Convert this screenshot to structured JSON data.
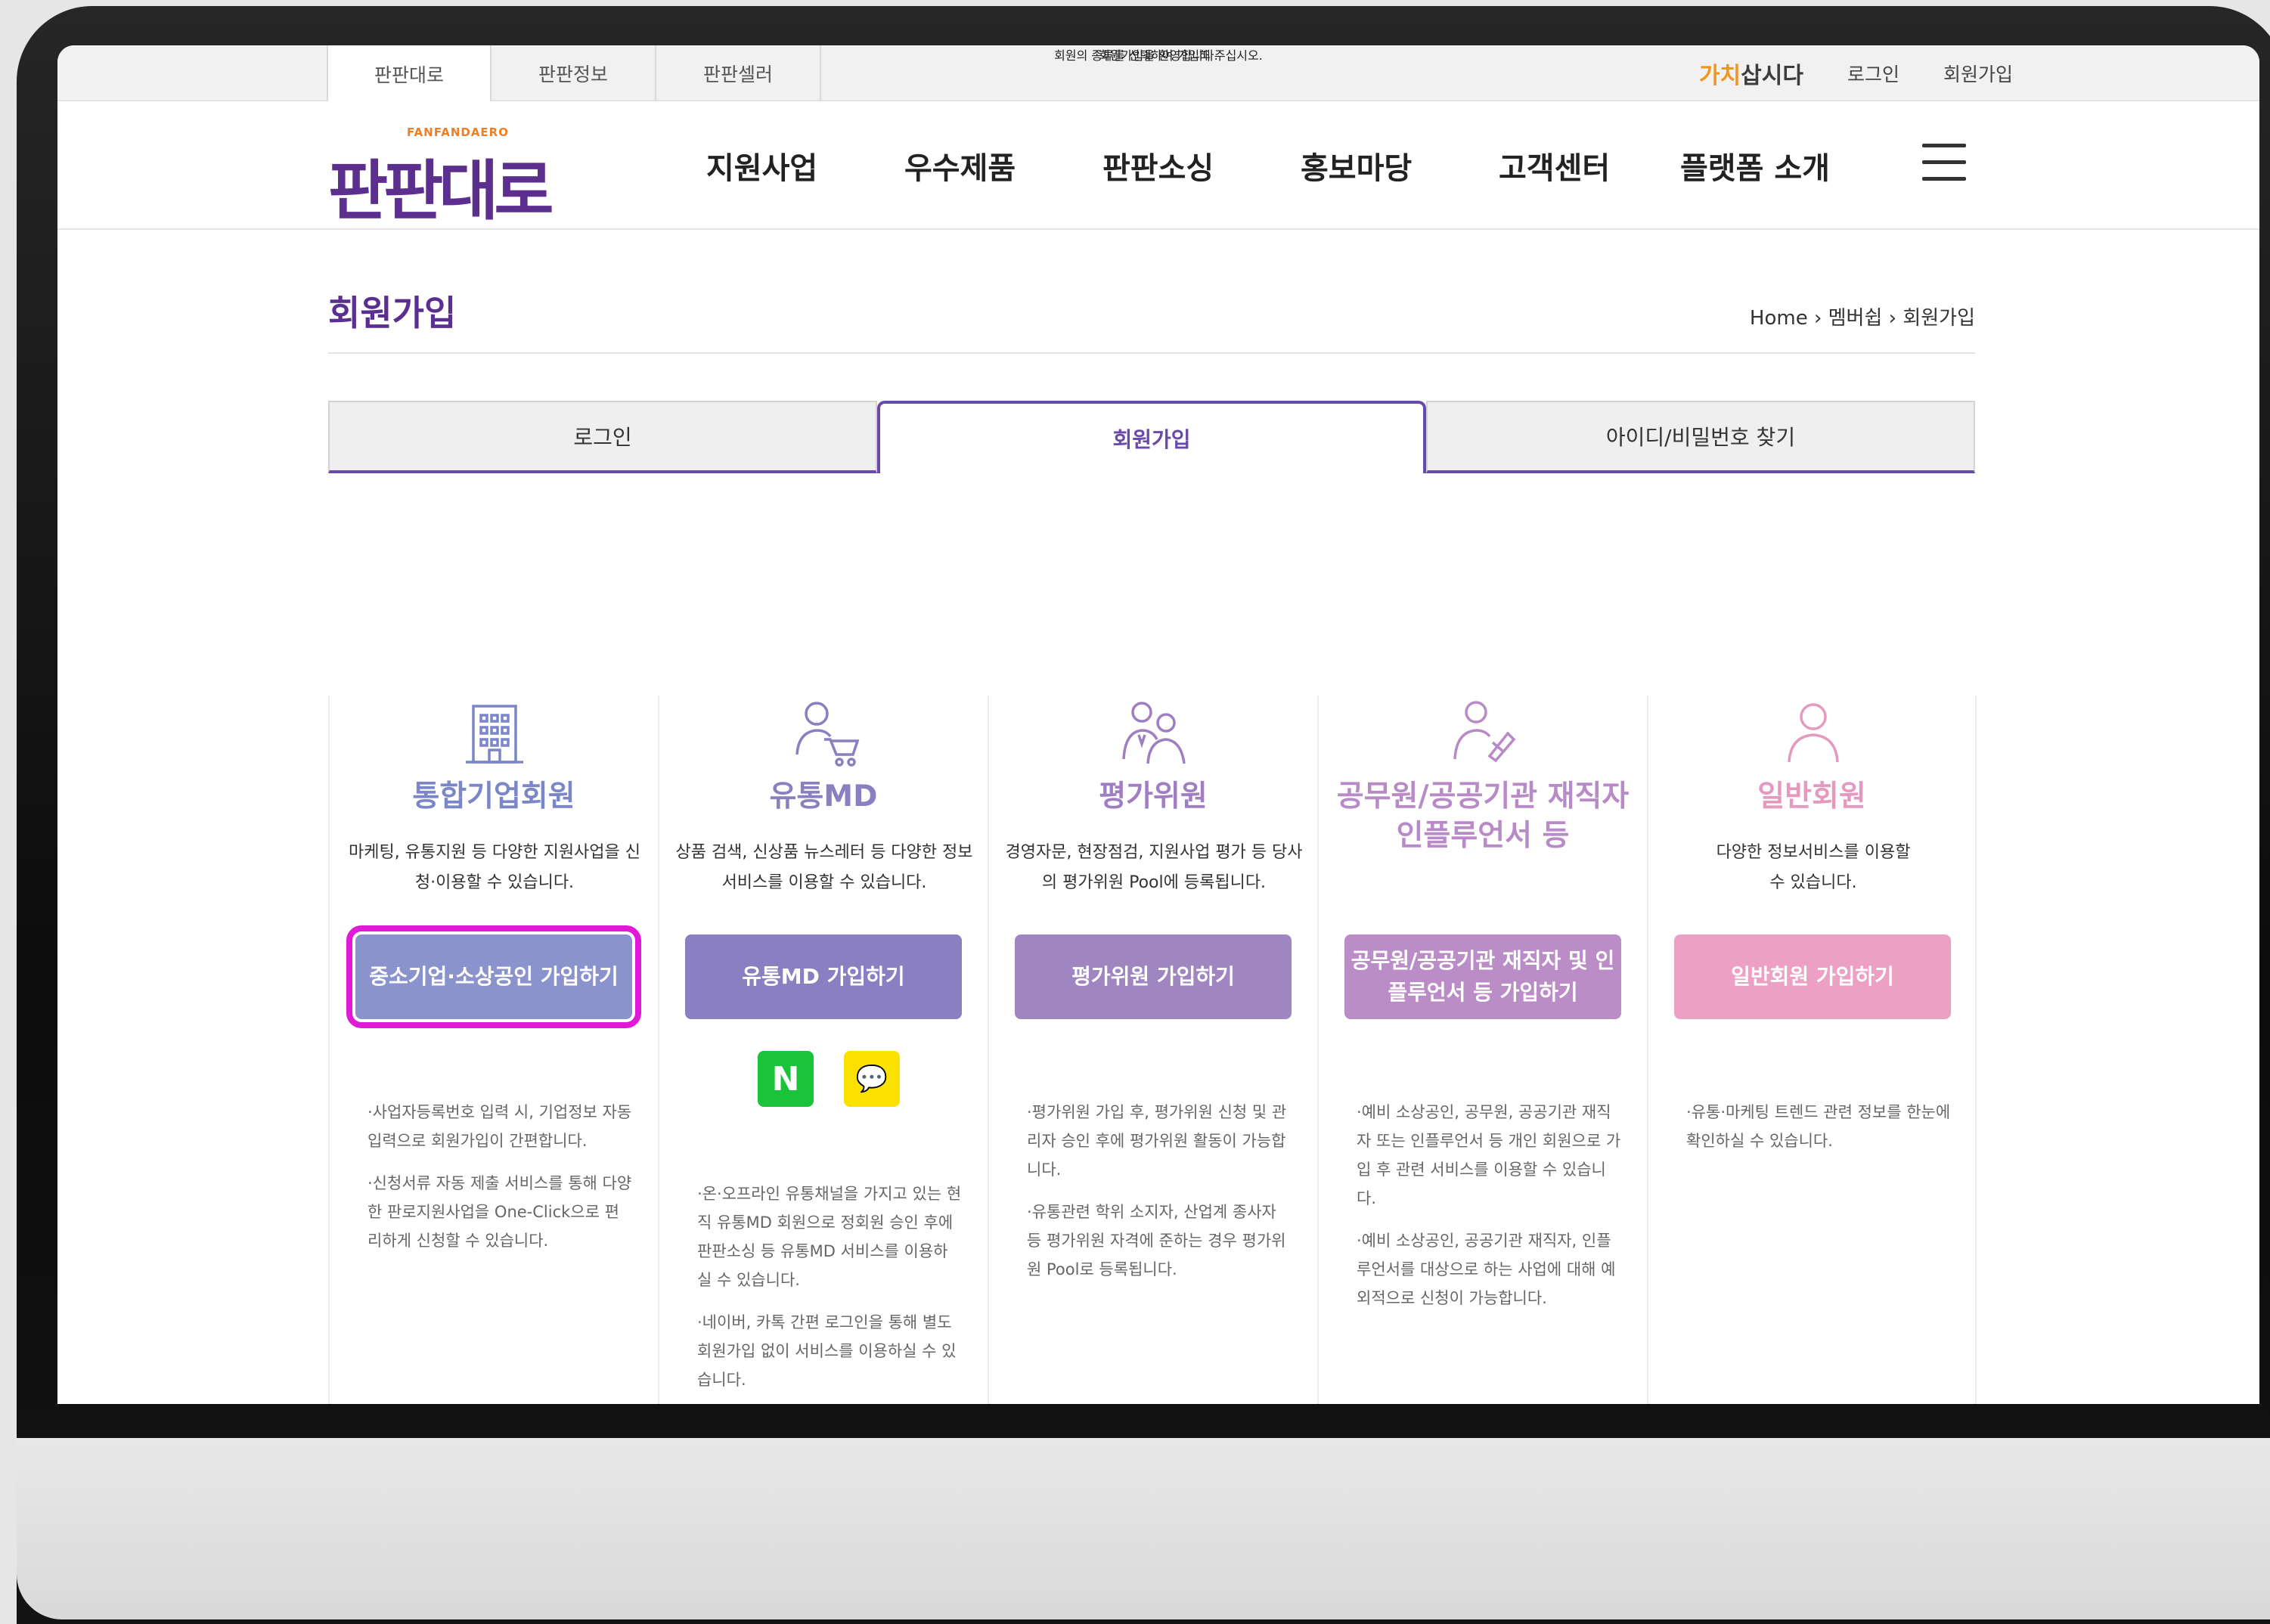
{
  "utilbar": {
    "tabs": [
      "판판대로",
      "판판정보",
      "판판셀러"
    ],
    "campaign_highlight": "가치",
    "campaign_rest": "삽시다",
    "login": "로그인",
    "signup": "회원가입"
  },
  "nav": {
    "logo_tag": "FANFANDAERO",
    "logo_word": "판판대로",
    "menu": [
      "지원사업",
      "우수제품",
      "판판소싱",
      "홍보마당",
      "고객센터",
      "플랫폼 소개"
    ]
  },
  "page": {
    "title": "회원가입",
    "breadcrumb": "Home › 멤버쉽 › 회원가입"
  },
  "tabs": [
    "로그인",
    "회원가입",
    "아이디/비밀번호 찾기"
  ],
  "welcome": {
    "line1": "회원가입을 환영합니다.",
    "line2": "회원의 종류를 선택하여 가입해 주십시오."
  },
  "members": [
    {
      "icon": "building-icon",
      "title": "통합기업회원",
      "desc": "마케팅, 유통지원 등 다양한 지원사업을 신청·이용할 수 있습니다.",
      "button": "중소기업·소상공인 가입하기",
      "notes": [
        "·사업자등록번호 입력 시, 기업정보 자동입력으로 회원가입이 간편합니다.",
        "·신청서류 자동 제출 서비스를 통해 다양한 판로지원사업을 One-Click으로 편리하게 신청할 수 있습니다."
      ],
      "color": "#8b93cc",
      "title_color": "#7b86c8"
    },
    {
      "icon": "shopping-cart-user-icon",
      "title": "유통MD",
      "desc": "상품 검색, 신상품 뉴스레터 등 다양한 정보서비스를 이용할 수 있습니다.",
      "button": "유통MD 가입하기",
      "notes": [
        "·온·오프라인 유통채널을 가지고 있는 현직 유통MD 회원으로 정회원 승인 후에 판판소싱 등 유통MD 서비스를 이용하실 수 있습니다.",
        "·네이버, 카톡 간편 로그인을 통해 별도 회원가입 없이 서비스를 이용하실 수 있습니다."
      ],
      "social": [
        "N",
        "💬"
      ],
      "color": "#8a7fc0",
      "title_color": "#8a7fc0"
    },
    {
      "icon": "evaluators-icon",
      "title": "평가위원",
      "desc": "경영자문, 현장점검, 지원사업 평가 등 당사의 평가위원 Pool에 등록됩니다.",
      "button": "평가위원 가입하기",
      "notes": [
        "·평가위원 가입 후, 평가위원 신청 및 관리자 승인 후에 평가위원 활동이 가능합니다.",
        "·유통관련 학위 소지자, 산업계 종사자 등 평가위원 자격에 준하는 경우 평가위원 Pool로 등록됩니다."
      ],
      "color": "#a086c0",
      "title_color": "#9f7fc2"
    },
    {
      "icon": "official-influencer-icon",
      "title": "공무원/공공기관 재직자 인플루언서 등",
      "desc": "",
      "button": "공무원/공공기관 재직자 및 인플루언서 등 가입하기",
      "notes": [
        "·예비 소상공인, 공무원, 공공기관 재직자 또는 인플루언서 등 개인 회원으로 가입 후 관련 서비스를 이용할 수 있습니다.",
        "·예비 소상공인, 공공기관 재직자, 인플루언서를 대상으로 하는 사업에 대해 예외적으로 신청이 가능합니다."
      ],
      "color": "#bb8dc6",
      "title_color": "#b88ac8"
    },
    {
      "icon": "user-icon",
      "title": "일반회원",
      "desc": "다양한 정보서비스를 이용할 수 있습니다.",
      "button": "일반회원 가입하기",
      "notes": [
        "·유통·마케팅 트렌드 관련 정보를 한눈에 확인하실 수 있습니다."
      ],
      "color": "#eba0c4",
      "title_color": "#e699bf"
    }
  ],
  "highlight_color": "#e11ad8"
}
